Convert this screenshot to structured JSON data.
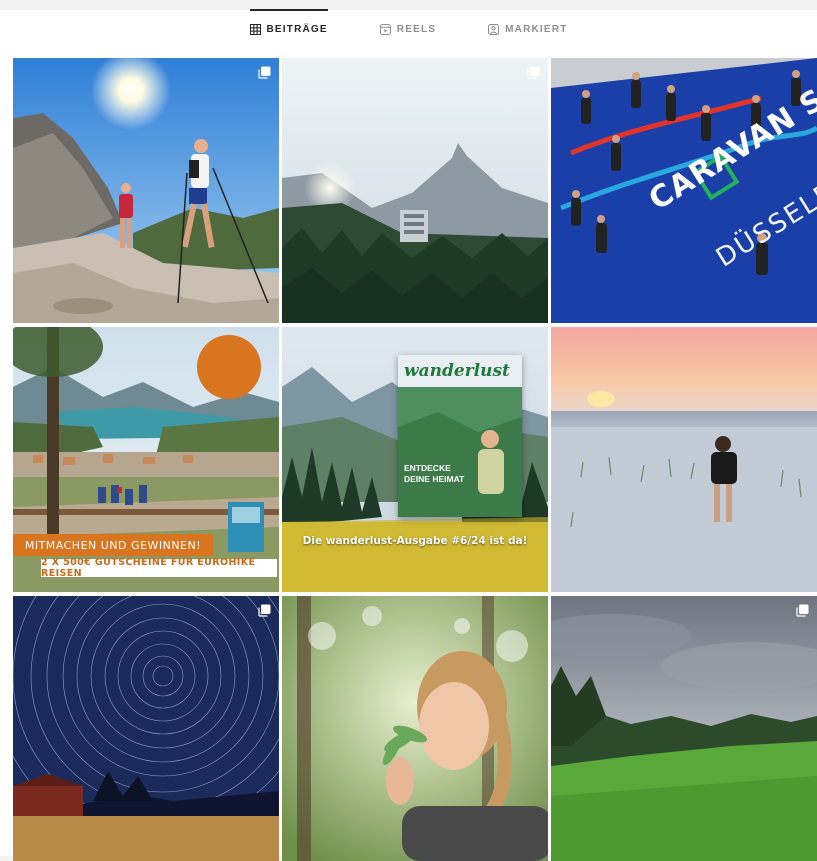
{
  "tabs": [
    {
      "label": "BEITRÄGE",
      "icon": "grid-icon",
      "active": true
    },
    {
      "label": "REELS",
      "icon": "reels-icon",
      "active": false
    },
    {
      "label": "MARKIERT",
      "icon": "tagged-icon",
      "active": false
    }
  ],
  "posts": {
    "p4": {
      "banner_main": "MITMACHEN UND GEWINNEN!",
      "banner_sub": "2 X 500€ GUTSCHEINE FÜR EUROHIKE REISEN"
    },
    "p5": {
      "mag_title": "wanderlust",
      "mag_cover_line1": "ENTDECKE",
      "mag_cover_line2": "DEINE HEIMAT",
      "caption": "Die wanderlust-Ausgabe #6/24 ist da!"
    },
    "p3": {
      "floor_text1": "CARAVAN SALON",
      "floor_text2": "DÜSSELDORF"
    }
  },
  "colors": {
    "active_tab": "#262626",
    "inactive_tab": "#8e8e8e",
    "accent_orange": "#d9741f"
  }
}
